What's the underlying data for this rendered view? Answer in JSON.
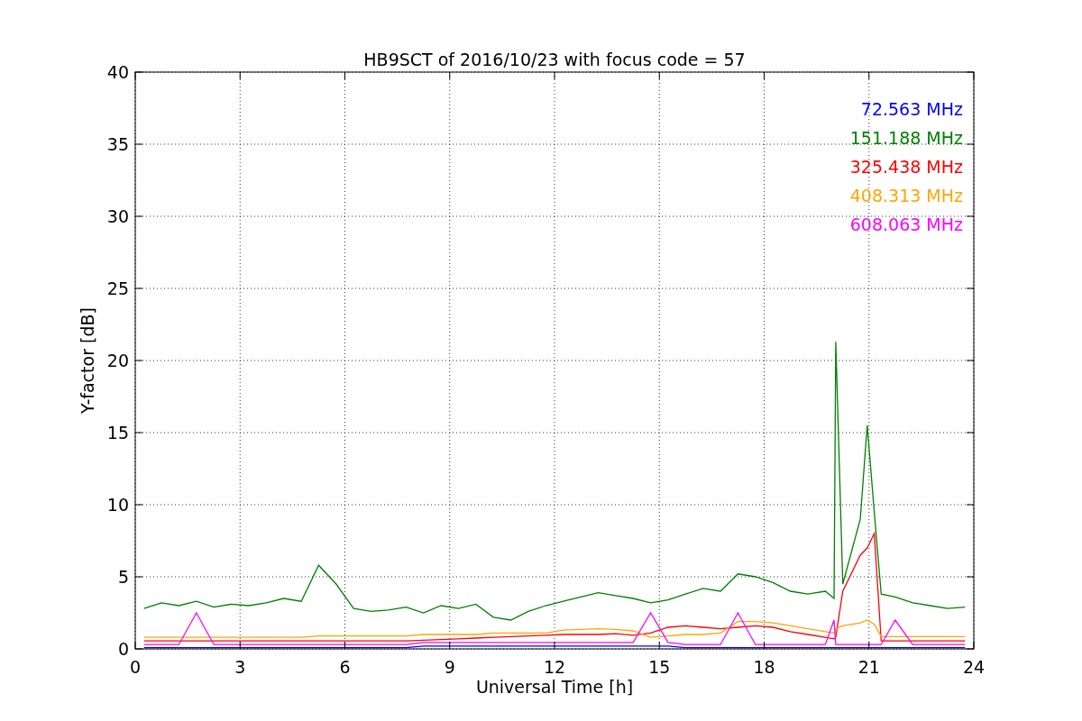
{
  "chart_data": {
    "type": "line",
    "title": "HB9SCT of 2016/10/23 with focus code = 57",
    "xlabel": "Universal Time [h]",
    "ylabel": "Y-factor [dB]",
    "x": [
      0.25,
      0.75,
      1.25,
      1.75,
      2.25,
      2.75,
      3.25,
      3.75,
      4.25,
      4.75,
      5.25,
      5.75,
      6.25,
      6.75,
      7.25,
      7.75,
      8.25,
      8.75,
      9.25,
      9.75,
      10.25,
      10.75,
      11.25,
      11.75,
      12.25,
      12.75,
      13.25,
      13.75,
      14.25,
      14.75,
      15.25,
      15.75,
      16.25,
      16.75,
      17.25,
      17.75,
      18.25,
      18.75,
      19.25,
      19.75,
      20.0,
      20.05,
      20.25,
      20.75,
      20.95,
      21.15,
      21.35,
      21.75,
      22.25,
      22.75,
      23.25,
      23.75
    ],
    "series": [
      {
        "name": "72.563 MHz",
        "color": "#0000ff",
        "values": [
          0.08,
          0.08,
          0.08,
          0.08,
          0.08,
          0.08,
          0.08,
          0.08,
          0.08,
          0.08,
          0.08,
          0.08,
          0.08,
          0.08,
          0.08,
          0.08,
          0.2,
          0.2,
          0.2,
          0.2,
          0.2,
          0.2,
          0.2,
          0.2,
          0.2,
          0.2,
          0.2,
          0.2,
          0.2,
          0.2,
          0.2,
          0.08,
          0.08,
          0.08,
          0.08,
          0.08,
          0.08,
          0.08,
          0.08,
          0.08,
          0.08,
          0.08,
          0.08,
          0.08,
          0.08,
          0.08,
          0.08,
          0.08,
          0.08,
          0.08,
          0.08,
          0.08
        ]
      },
      {
        "name": "151.188 MHz",
        "color": "#008000",
        "values": [
          2.8,
          3.2,
          3.0,
          3.3,
          2.9,
          3.1,
          3.0,
          3.2,
          3.5,
          3.3,
          5.8,
          4.5,
          2.8,
          2.6,
          2.7,
          2.9,
          2.5,
          3.0,
          2.8,
          3.1,
          2.2,
          2.0,
          2.6,
          3.0,
          3.3,
          3.6,
          3.9,
          3.7,
          3.5,
          3.2,
          3.4,
          3.8,
          4.2,
          4.0,
          5.2,
          5.0,
          4.6,
          4.0,
          3.8,
          4.0,
          3.5,
          21.3,
          4.5,
          9.0,
          15.5,
          9.5,
          3.8,
          3.6,
          3.2,
          3.0,
          2.8,
          2.9
        ]
      },
      {
        "name": "325.438 MHz",
        "color": "#ff0000",
        "values": [
          0.55,
          0.55,
          0.55,
          0.55,
          0.55,
          0.55,
          0.55,
          0.55,
          0.55,
          0.55,
          0.55,
          0.55,
          0.55,
          0.55,
          0.55,
          0.55,
          0.6,
          0.65,
          0.7,
          0.75,
          0.8,
          0.85,
          0.9,
          0.95,
          1.0,
          1.0,
          1.0,
          1.05,
          0.95,
          1.1,
          1.5,
          1.6,
          1.5,
          1.4,
          1.5,
          1.6,
          1.5,
          1.2,
          1.0,
          0.8,
          0.7,
          0.8,
          4.0,
          6.5,
          7.0,
          8.0,
          0.55,
          0.55,
          0.55,
          0.55,
          0.55,
          0.55
        ]
      },
      {
        "name": "408.313 MHz",
        "color": "#ffa500",
        "values": [
          0.8,
          0.8,
          0.8,
          0.8,
          0.8,
          0.8,
          0.8,
          0.8,
          0.8,
          0.8,
          0.9,
          0.9,
          0.9,
          0.9,
          0.9,
          0.9,
          1.0,
          1.0,
          1.0,
          1.0,
          1.1,
          1.1,
          1.1,
          1.1,
          1.3,
          1.35,
          1.4,
          1.35,
          1.25,
          0.8,
          0.9,
          1.0,
          1.0,
          1.1,
          1.9,
          1.9,
          1.8,
          1.6,
          1.4,
          1.2,
          1.1,
          1.4,
          1.6,
          1.8,
          2.0,
          1.7,
          0.85,
          0.85,
          0.85,
          0.85,
          0.85,
          0.85
        ]
      },
      {
        "name": "608.063 MHz",
        "color": "#ff00ff",
        "values": [
          0.3,
          0.3,
          0.3,
          2.5,
          0.3,
          0.3,
          0.3,
          0.3,
          0.3,
          0.3,
          0.3,
          0.3,
          0.3,
          0.3,
          0.3,
          0.3,
          0.45,
          0.45,
          0.45,
          0.45,
          0.45,
          0.45,
          0.45,
          0.45,
          0.45,
          0.45,
          0.45,
          0.45,
          0.45,
          2.5,
          0.45,
          0.3,
          0.3,
          0.3,
          2.5,
          0.3,
          0.3,
          0.3,
          0.3,
          0.3,
          2.0,
          0.3,
          0.3,
          0.3,
          0.3,
          0.3,
          0.3,
          2.0,
          0.3,
          0.3,
          0.3,
          0.3
        ]
      }
    ],
    "xlim": [
      0,
      24
    ],
    "ylim": [
      0,
      40
    ],
    "xticks": [
      0,
      3,
      6,
      9,
      12,
      15,
      18,
      21,
      24
    ],
    "yticks": [
      0,
      5,
      10,
      15,
      20,
      25,
      30,
      35,
      40
    ],
    "grid": true
  }
}
